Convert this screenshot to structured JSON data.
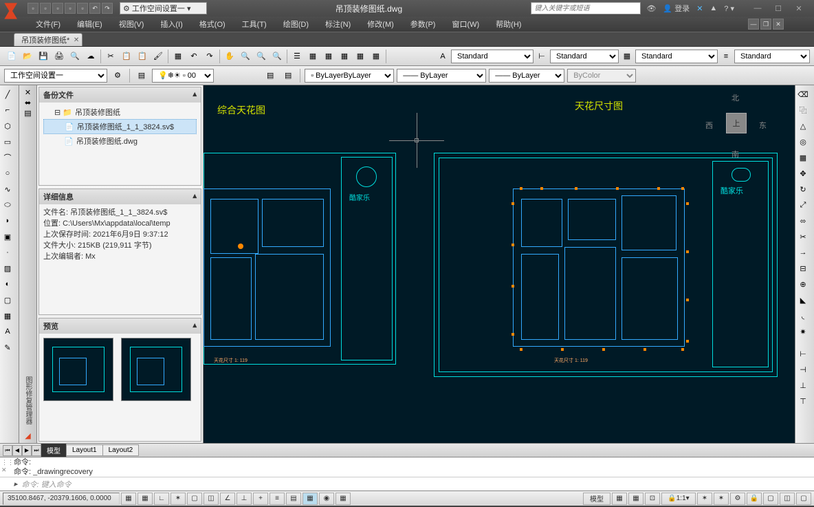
{
  "title": "吊顶装修图纸.dwg",
  "workspace": "工作空间设置一",
  "search_placeholder": "键入关键字或短语",
  "login": "登录",
  "menu": [
    "文件(F)",
    "编辑(E)",
    "视图(V)",
    "插入(I)",
    "格式(O)",
    "工具(T)",
    "绘图(D)",
    "标注(N)",
    "修改(M)",
    "参数(P)",
    "窗口(W)",
    "帮助(H)"
  ],
  "filetab": "吊顶装修图纸*",
  "styles": {
    "text": "Standard",
    "dim": "Standard",
    "table": "Standard",
    "ml": "Standard"
  },
  "props": {
    "layer": "0",
    "color": "ByLayer",
    "ltype": "ByLayer",
    "lweight": "ByLayer",
    "pstyle": "ByColor"
  },
  "workspace2": "工作空间设置一",
  "recovery": {
    "sec1": "备份文件",
    "root": "吊顶装修图纸",
    "item1": "吊顶装修图纸_1_1_3824.sv$",
    "item2": "吊顶装修图纸.dwg",
    "sec2": "详细信息",
    "d1": "文件名: 吊顶装修图纸_1_1_3824.sv$",
    "d2": "位置: C:\\Users\\Mx\\appdata\\local\\temp",
    "d3": "上次保存时间: 2021年6月9日  9:37:12",
    "d4": "文件大小: 215KB (219,911 字节)",
    "d5": "上次编辑者: Mx",
    "sec3": "预览",
    "palette_title": "图形修复管理器"
  },
  "viewport": {
    "title1": "综合天花图",
    "title2": "天花尺寸图",
    "logo1": "酷家乐",
    "logo2": "酷家乐",
    "scale1": "天花尺寸 1: 119",
    "compass": {
      "n": "北",
      "s": "南",
      "e": "东",
      "w": "西",
      "c": "上"
    }
  },
  "layout_tabs": [
    "模型",
    "Layout1",
    "Layout2"
  ],
  "cmd": {
    "h1": "命令:",
    "h2": "命令: _drawingrecovery",
    "prompt": "命令: 键入命令"
  },
  "status": {
    "coords": "35100.8467, -20379.1606, 0.0000",
    "model": "模型",
    "scale": "1:1"
  }
}
